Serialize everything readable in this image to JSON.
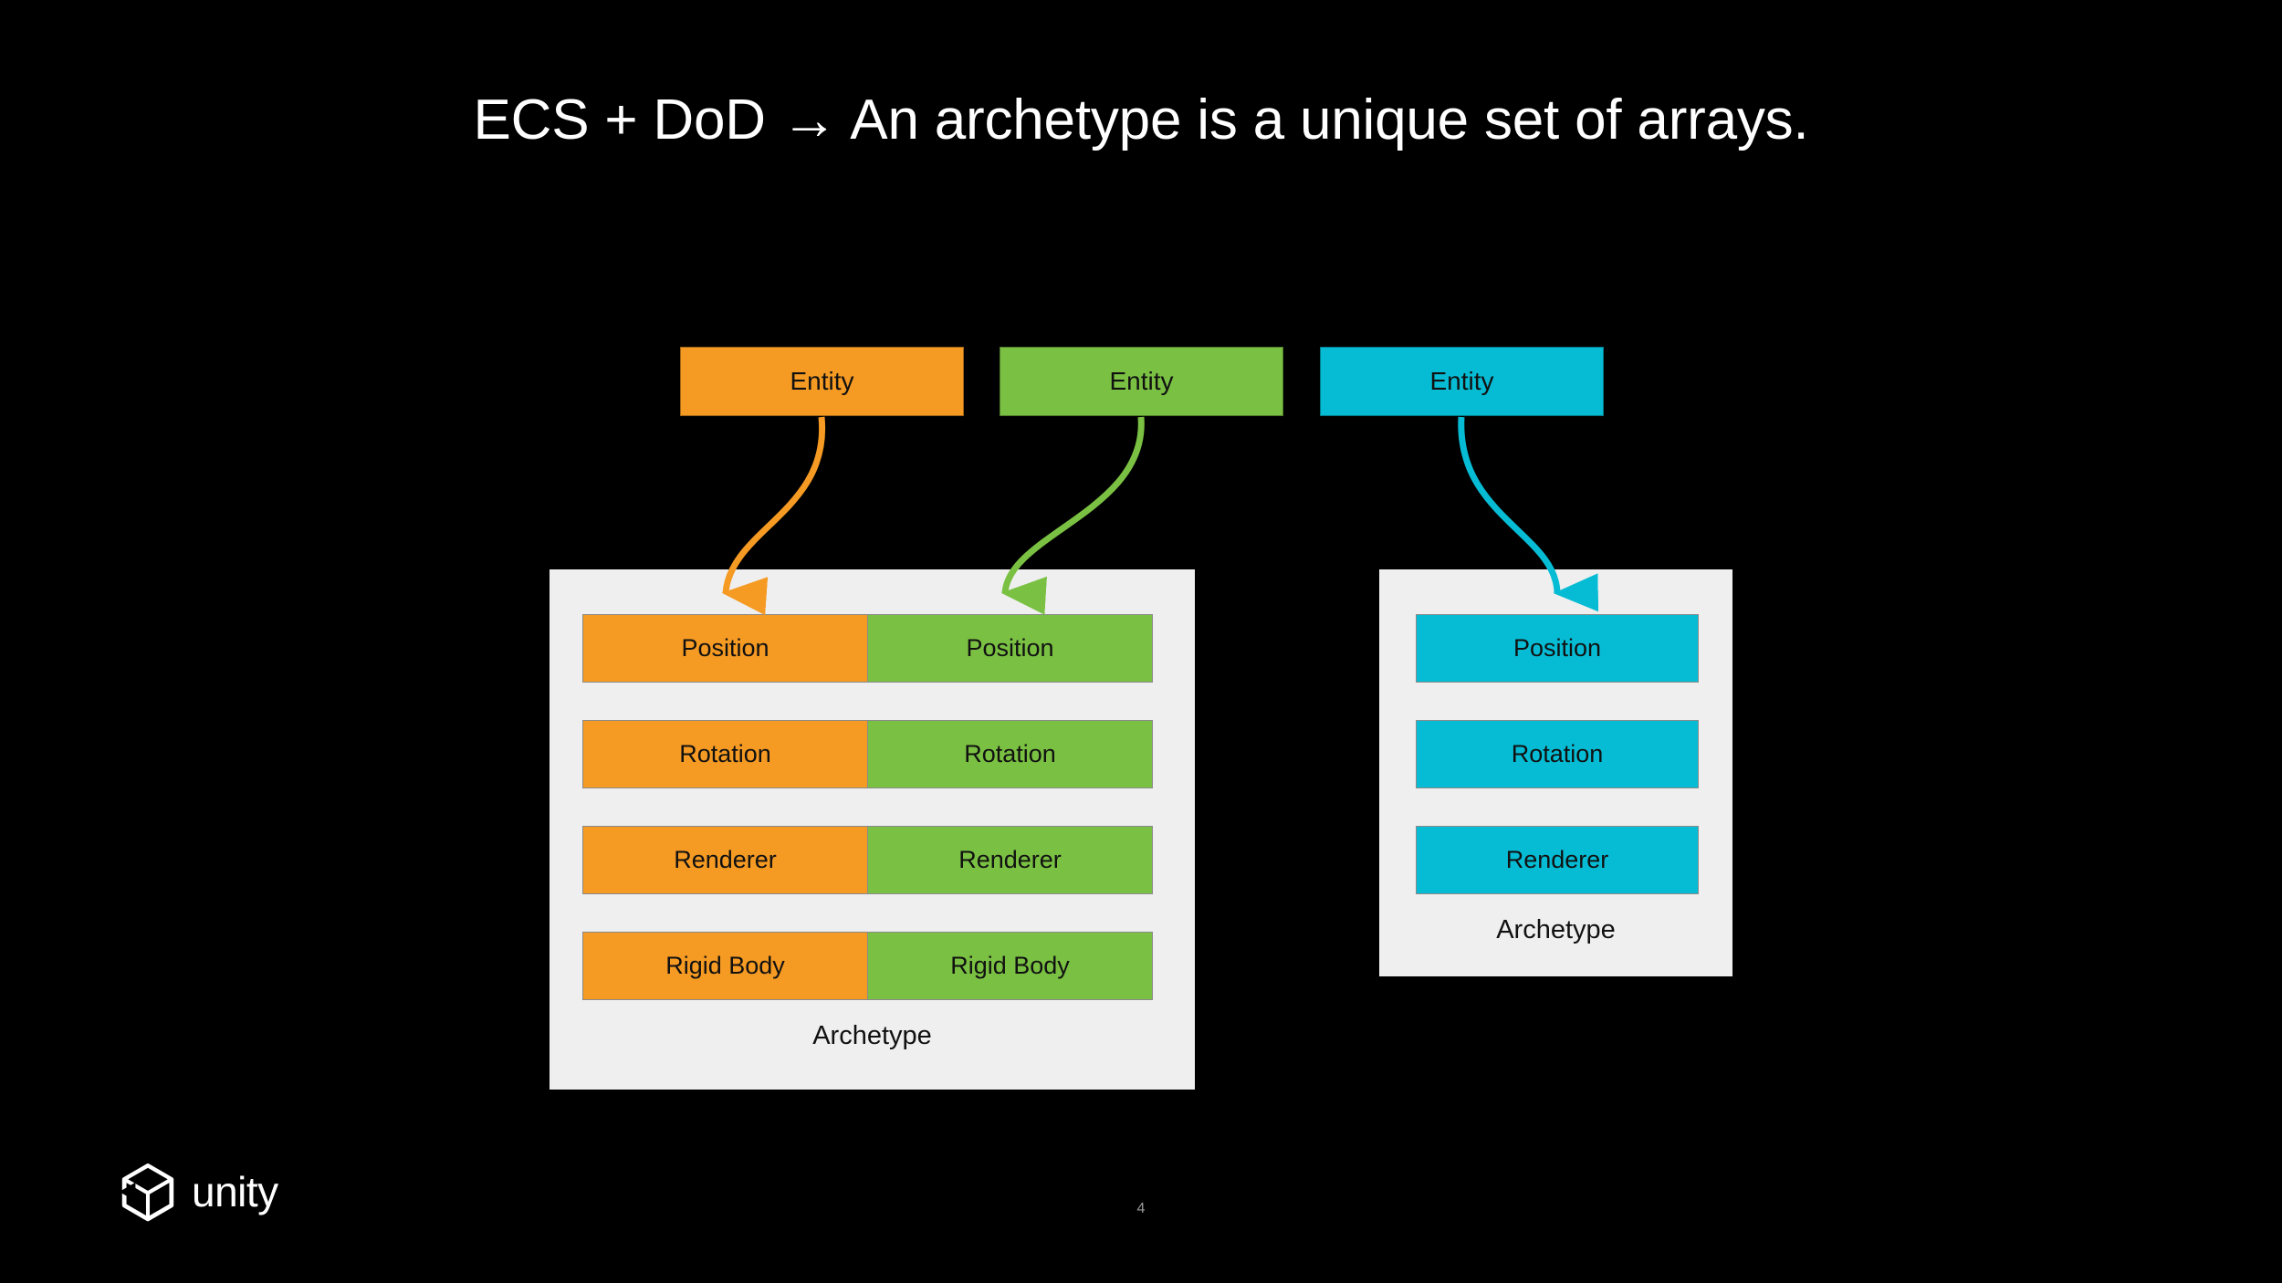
{
  "slide": {
    "title": "ECS + DoD → An archetype is a unique set of arrays.",
    "page_number": "4",
    "background_color": "#000000",
    "title_color": "#ffffff"
  },
  "colors": {
    "orange": "#F59A23",
    "green": "#7AC143",
    "cyan": "#06BCD4",
    "panel_background": "#EFEFEF",
    "cell_border": "#8a8a8a",
    "label_text": "#111111"
  },
  "entities": [
    {
      "label": "Entity",
      "color_name": "orange",
      "color": "#F59A23"
    },
    {
      "label": "Entity",
      "color_name": "green",
      "color": "#7AC143"
    },
    {
      "label": "Entity",
      "color_name": "cyan",
      "color": "#06BCD4"
    }
  ],
  "archetypes": [
    {
      "caption": "Archetype",
      "rows": [
        {
          "cells": [
            {
              "label": "Position",
              "color": "#F59A23"
            },
            {
              "label": "Position",
              "color": "#7AC143"
            }
          ]
        },
        {
          "cells": [
            {
              "label": "Rotation",
              "color": "#F59A23"
            },
            {
              "label": "Rotation",
              "color": "#7AC143"
            }
          ]
        },
        {
          "cells": [
            {
              "label": "Renderer",
              "color": "#F59A23"
            },
            {
              "label": "Renderer",
              "color": "#7AC143"
            }
          ]
        },
        {
          "cells": [
            {
              "label": "Rigid Body",
              "color": "#F59A23"
            },
            {
              "label": "Rigid Body",
              "color": "#7AC143"
            }
          ]
        }
      ]
    },
    {
      "caption": "Archetype",
      "rows": [
        {
          "cells": [
            {
              "label": "Position",
              "color": "#06BCD4"
            }
          ]
        },
        {
          "cells": [
            {
              "label": "Rotation",
              "color": "#06BCD4"
            }
          ]
        },
        {
          "cells": [
            {
              "label": "Renderer",
              "color": "#06BCD4"
            }
          ]
        }
      ]
    }
  ],
  "connectors": [
    {
      "name": "orange-entity-to-left-archetype",
      "color": "#F59A23",
      "direction": "down-left"
    },
    {
      "name": "green-entity-to-left-archetype",
      "color": "#7AC143",
      "direction": "down-left"
    },
    {
      "name": "cyan-entity-to-right-archetype",
      "color": "#06BCD4",
      "direction": "down-right"
    }
  ],
  "footer": {
    "brand": "unity",
    "logo_icon": "unity-cube-icon"
  }
}
